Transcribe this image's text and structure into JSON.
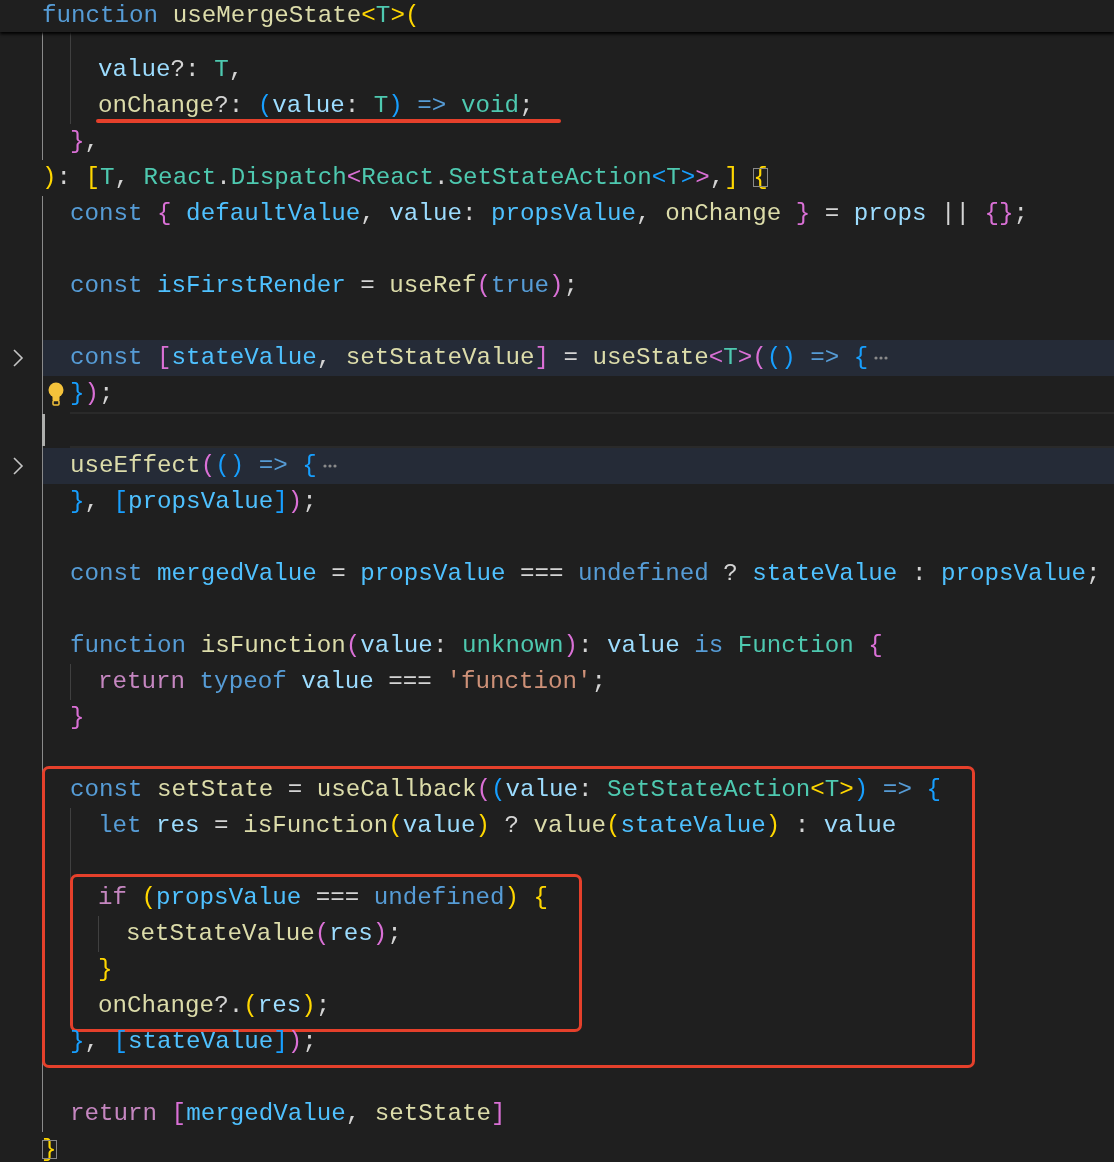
{
  "editor": {
    "lines": [
      {
        "kind": "sticky",
        "tokens": [
          {
            "text": "function ",
            "kind": "k"
          },
          {
            "text": "useMergeState",
            "kind": "f"
          },
          {
            "text": "<",
            "kind": "b1"
          },
          {
            "text": "T",
            "kind": "t"
          },
          {
            "text": ">",
            "kind": "b1"
          },
          {
            "text": "(",
            "kind": "b1"
          }
        ],
        "children": [
          {
            "kind": "code",
            "children": [
              {
                "kind": "blank"
              },
              {
                "kind": "code",
                "tokens": [
                  {
                    "text": "value",
                    "kind": "v"
                  },
                  {
                    "text": "?: ",
                    "kind": "p"
                  },
                  {
                    "text": "T",
                    "kind": "t"
                  },
                  {
                    "text": ",",
                    "kind": "p"
                  }
                ]
              },
              {
                "kind": "code",
                "underlined": true,
                "tokens": [
                  {
                    "text": "onChange",
                    "kind": "f"
                  },
                  {
                    "text": "?: ",
                    "kind": "p"
                  },
                  {
                    "text": "(",
                    "kind": "b3"
                  },
                  {
                    "text": "value",
                    "kind": "v"
                  },
                  {
                    "text": ": ",
                    "kind": "p"
                  },
                  {
                    "text": "T",
                    "kind": "t"
                  },
                  {
                    "text": ")",
                    "kind": "b3"
                  },
                  {
                    "text": " => ",
                    "kind": "k"
                  },
                  {
                    "text": "void",
                    "kind": "t"
                  },
                  {
                    "text": ";",
                    "kind": "p"
                  }
                ]
              }
            ],
            "end": [
              {
                "text": "}",
                "kind": "b2"
              },
              {
                "text": ",",
                "kind": "p"
              }
            ]
          }
        ],
        "end": [
          {
            "text": ")",
            "kind": "b1"
          },
          {
            "text": ": ",
            "kind": "p"
          },
          {
            "text": "[",
            "kind": "b1"
          },
          {
            "text": "T",
            "kind": "t"
          },
          {
            "text": ", ",
            "kind": "p"
          },
          {
            "text": "React",
            "kind": "t"
          },
          {
            "text": ".",
            "kind": "p"
          },
          {
            "text": "Dispatch",
            "kind": "t"
          },
          {
            "text": "<",
            "kind": "b2"
          },
          {
            "text": "React",
            "kind": "t"
          },
          {
            "text": ".",
            "kind": "p"
          },
          {
            "text": "SetStateAction",
            "kind": "t"
          },
          {
            "text": "<",
            "kind": "b3"
          },
          {
            "text": "T",
            "kind": "t"
          },
          {
            "text": ">",
            "kind": "b3"
          },
          {
            "text": ">",
            "kind": "b2"
          },
          {
            "text": ",",
            "kind": "p"
          },
          {
            "text": "] ",
            "kind": "b1"
          },
          {
            "text": "{",
            "kind": "b1",
            "matched": true
          }
        ]
      },
      {
        "kind": "code",
        "children": [
          {
            "kind": "code",
            "tokens": [
              {
                "text": "const ",
                "kind": "k"
              },
              {
                "text": "{",
                "kind": "b2"
              },
              {
                "text": " defaultValue",
                "kind": "cv"
              },
              {
                "text": ", ",
                "kind": "p"
              },
              {
                "text": "value",
                "kind": "v"
              },
              {
                "text": ": ",
                "kind": "p"
              },
              {
                "text": "propsValue",
                "kind": "cv"
              },
              {
                "text": ", ",
                "kind": "p"
              },
              {
                "text": "onChange",
                "kind": "f"
              },
              {
                "text": " }",
                "kind": "b2"
              },
              {
                "text": " = ",
                "kind": "p"
              },
              {
                "text": "props",
                "kind": "v"
              },
              {
                "text": " || ",
                "kind": "p"
              },
              {
                "text": "{}",
                "kind": "b2"
              },
              {
                "text": ";",
                "kind": "p"
              }
            ]
          },
          {
            "kind": "blank"
          },
          {
            "kind": "code",
            "tokens": [
              {
                "text": "const ",
                "kind": "k"
              },
              {
                "text": "isFirstRender",
                "kind": "cv"
              },
              {
                "text": " = ",
                "kind": "p"
              },
              {
                "text": "useRef",
                "kind": "f"
              },
              {
                "text": "(",
                "kind": "b2"
              },
              {
                "text": "true",
                "kind": "k"
              },
              {
                "text": ")",
                "kind": "b2"
              },
              {
                "text": ";",
                "kind": "p"
              }
            ]
          },
          {
            "kind": "blank"
          },
          {
            "kind": "folded",
            "bulb": true,
            "tokens": [
              {
                "text": "const ",
                "kind": "k"
              },
              {
                "text": "[",
                "kind": "b2"
              },
              {
                "text": "stateValue",
                "kind": "cv"
              },
              {
                "text": ", ",
                "kind": "p"
              },
              {
                "text": "setStateValue",
                "kind": "f"
              },
              {
                "text": "]",
                "kind": "b2"
              },
              {
                "text": " = ",
                "kind": "p"
              },
              {
                "text": "useState",
                "kind": "f"
              },
              {
                "text": "<",
                "kind": "b2"
              },
              {
                "text": "T",
                "kind": "t"
              },
              {
                "text": ">",
                "kind": "b2"
              },
              {
                "text": "(",
                "kind": "b2"
              },
              {
                "text": "()",
                "kind": "b3"
              },
              {
                "text": " => ",
                "kind": "k"
              },
              {
                "text": "{",
                "kind": "b3"
              }
            ],
            "end": [
              {
                "text": "}",
                "kind": "b3"
              },
              {
                "text": ")",
                "kind": "b2"
              },
              {
                "text": ";",
                "kind": "p"
              }
            ]
          },
          {
            "kind": "cursor"
          },
          {
            "kind": "folded",
            "tokens": [
              {
                "text": "useEffect",
                "kind": "f"
              },
              {
                "text": "(",
                "kind": "b2"
              },
              {
                "text": "()",
                "kind": "b3"
              },
              {
                "text": " => ",
                "kind": "k"
              },
              {
                "text": "{",
                "kind": "b3"
              }
            ],
            "end": [
              {
                "text": "}",
                "kind": "b3"
              },
              {
                "text": ", ",
                "kind": "p"
              },
              {
                "text": "[",
                "kind": "b3"
              },
              {
                "text": "propsValue",
                "kind": "cv"
              },
              {
                "text": "]",
                "kind": "b3"
              },
              {
                "text": ")",
                "kind": "b2"
              },
              {
                "text": ";",
                "kind": "p"
              }
            ]
          },
          {
            "kind": "blank"
          },
          {
            "kind": "code",
            "tokens": [
              {
                "text": "const ",
                "kind": "k"
              },
              {
                "text": "mergedValue",
                "kind": "cv"
              },
              {
                "text": " = ",
                "kind": "p"
              },
              {
                "text": "propsValue",
                "kind": "cv"
              },
              {
                "text": " === ",
                "kind": "p"
              },
              {
                "text": "undefined",
                "kind": "k"
              },
              {
                "text": " ? ",
                "kind": "p"
              },
              {
                "text": "stateValue",
                "kind": "cv"
              },
              {
                "text": " : ",
                "kind": "p"
              },
              {
                "text": "propsValue",
                "kind": "cv"
              },
              {
                "text": ";",
                "kind": "p"
              }
            ]
          },
          {
            "kind": "blank"
          },
          {
            "kind": "code",
            "tokens": [
              {
                "text": "function ",
                "kind": "k"
              },
              {
                "text": "isFunction",
                "kind": "f"
              },
              {
                "text": "(",
                "kind": "b2"
              },
              {
                "text": "value",
                "kind": "v"
              },
              {
                "text": ": ",
                "kind": "p"
              },
              {
                "text": "unknown",
                "kind": "t"
              },
              {
                "text": ")",
                "kind": "b2"
              },
              {
                "text": ": ",
                "kind": "p"
              },
              {
                "text": "value",
                "kind": "v"
              },
              {
                "text": " is ",
                "kind": "k"
              },
              {
                "text": "Function",
                "kind": "t"
              },
              {
                "text": " {",
                "kind": "b2"
              }
            ],
            "children": [
              {
                "kind": "code",
                "tokens": [
                  {
                    "text": "return ",
                    "kind": "c"
                  },
                  {
                    "text": "typeof ",
                    "kind": "k"
                  },
                  {
                    "text": "value",
                    "kind": "v"
                  },
                  {
                    "text": " === ",
                    "kind": "p"
                  },
                  {
                    "text": "'function'",
                    "kind": "s"
                  },
                  {
                    "text": ";",
                    "kind": "p"
                  }
                ]
              }
            ],
            "end": [
              {
                "text": "}",
                "kind": "b2"
              }
            ]
          },
          {
            "kind": "blank"
          },
          {
            "kind": "box",
            "lines": [
              {
                "kind": "code",
                "tokens": [
                  {
                    "text": "const ",
                    "kind": "k"
                  },
                  {
                    "text": "setState",
                    "kind": "f"
                  },
                  {
                    "text": " = ",
                    "kind": "p"
                  },
                  {
                    "text": "useCallback",
                    "kind": "f"
                  },
                  {
                    "text": "(",
                    "kind": "b2"
                  },
                  {
                    "text": "(",
                    "kind": "b3"
                  },
                  {
                    "text": "value",
                    "kind": "v"
                  },
                  {
                    "text": ": ",
                    "kind": "p"
                  },
                  {
                    "text": "SetStateAction",
                    "kind": "t"
                  },
                  {
                    "text": "<",
                    "kind": "b1"
                  },
                  {
                    "text": "T",
                    "kind": "t"
                  },
                  {
                    "text": ">",
                    "kind": "b1"
                  },
                  {
                    "text": ")",
                    "kind": "b3"
                  },
                  {
                    "text": " => ",
                    "kind": "k"
                  },
                  {
                    "text": "{",
                    "kind": "b3"
                  }
                ],
                "children": [
                  {
                    "kind": "code",
                    "tokens": [
                      {
                        "text": "let ",
                        "kind": "k"
                      },
                      {
                        "text": "res",
                        "kind": "v"
                      },
                      {
                        "text": " = ",
                        "kind": "p"
                      },
                      {
                        "text": "isFunction",
                        "kind": "f"
                      },
                      {
                        "text": "(",
                        "kind": "b1"
                      },
                      {
                        "text": "value",
                        "kind": "v"
                      },
                      {
                        "text": ")",
                        "kind": "b1"
                      },
                      {
                        "text": " ? ",
                        "kind": "p"
                      },
                      {
                        "text": "value",
                        "kind": "f"
                      },
                      {
                        "text": "(",
                        "kind": "b1"
                      },
                      {
                        "text": "stateValue",
                        "kind": "cv"
                      },
                      {
                        "text": ")",
                        "kind": "b1"
                      },
                      {
                        "text": " : ",
                        "kind": "p"
                      },
                      {
                        "text": "value",
                        "kind": "v"
                      }
                    ]
                  },
                  {
                    "kind": "blank"
                  },
                  {
                    "kind": "box",
                    "lines": [
                      {
                        "kind": "code",
                        "tokens": [
                          {
                            "text": "if ",
                            "kind": "c"
                          },
                          {
                            "text": "(",
                            "kind": "b1"
                          },
                          {
                            "text": "propsValue",
                            "kind": "cv"
                          },
                          {
                            "text": " === ",
                            "kind": "p"
                          },
                          {
                            "text": "undefined",
                            "kind": "k"
                          },
                          {
                            "text": ")",
                            "kind": "b1"
                          },
                          {
                            "text": " {",
                            "kind": "b1"
                          }
                        ],
                        "children": [
                          {
                            "kind": "code",
                            "tokens": [
                              {
                                "text": "setStateValue",
                                "kind": "f"
                              },
                              {
                                "text": "(",
                                "kind": "b2"
                              },
                              {
                                "text": "res",
                                "kind": "v"
                              },
                              {
                                "text": ")",
                                "kind": "b2"
                              },
                              {
                                "text": ";",
                                "kind": "p"
                              }
                            ]
                          }
                        ],
                        "end": [
                          {
                            "text": "}",
                            "kind": "b1"
                          }
                        ]
                      },
                      {
                        "kind": "code",
                        "tokens": [
                          {
                            "text": "onChange",
                            "kind": "f"
                          },
                          {
                            "text": "?.",
                            "kind": "p"
                          },
                          {
                            "text": "(",
                            "kind": "b1"
                          },
                          {
                            "text": "res",
                            "kind": "v"
                          },
                          {
                            "text": ")",
                            "kind": "b1"
                          },
                          {
                            "text": ";",
                            "kind": "p"
                          }
                        ]
                      }
                    ]
                  }
                ],
                "end": [
                  {
                    "text": "}",
                    "kind": "b3"
                  },
                  {
                    "text": ", ",
                    "kind": "p"
                  },
                  {
                    "text": "[",
                    "kind": "b3"
                  },
                  {
                    "text": "stateValue",
                    "kind": "cv"
                  },
                  {
                    "text": "]",
                    "kind": "b3"
                  },
                  {
                    "text": ")",
                    "kind": "b2"
                  },
                  {
                    "text": ";",
                    "kind": "p"
                  }
                ]
              }
            ]
          },
          {
            "kind": "blank"
          },
          {
            "kind": "code",
            "tokens": [
              {
                "text": "return ",
                "kind": "c"
              },
              {
                "text": "[",
                "kind": "b2"
              },
              {
                "text": "mergedValue",
                "kind": "cv"
              },
              {
                "text": ", ",
                "kind": "p"
              },
              {
                "text": "setState",
                "kind": "f"
              },
              {
                "text": "]",
                "kind": "b2"
              }
            ]
          }
        ],
        "end": [
          {
            "text": "}",
            "kind": "b1",
            "matched": true
          }
        ]
      }
    ]
  }
}
